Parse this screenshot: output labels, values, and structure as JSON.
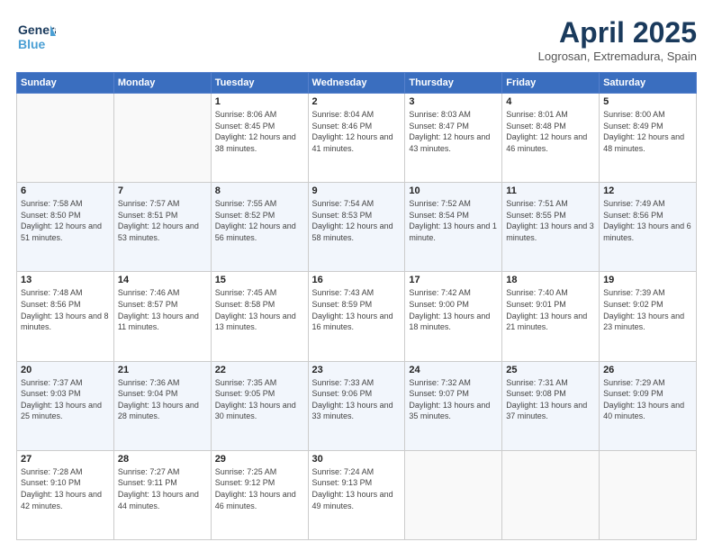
{
  "header": {
    "logo_general": "General",
    "logo_blue": "Blue",
    "month": "April 2025",
    "location": "Logrosan, Extremadura, Spain"
  },
  "days_of_week": [
    "Sunday",
    "Monday",
    "Tuesday",
    "Wednesday",
    "Thursday",
    "Friday",
    "Saturday"
  ],
  "weeks": [
    [
      {
        "day": "",
        "info": ""
      },
      {
        "day": "",
        "info": ""
      },
      {
        "day": "1",
        "info": "Sunrise: 8:06 AM\nSunset: 8:45 PM\nDaylight: 12 hours and 38 minutes."
      },
      {
        "day": "2",
        "info": "Sunrise: 8:04 AM\nSunset: 8:46 PM\nDaylight: 12 hours and 41 minutes."
      },
      {
        "day": "3",
        "info": "Sunrise: 8:03 AM\nSunset: 8:47 PM\nDaylight: 12 hours and 43 minutes."
      },
      {
        "day": "4",
        "info": "Sunrise: 8:01 AM\nSunset: 8:48 PM\nDaylight: 12 hours and 46 minutes."
      },
      {
        "day": "5",
        "info": "Sunrise: 8:00 AM\nSunset: 8:49 PM\nDaylight: 12 hours and 48 minutes."
      }
    ],
    [
      {
        "day": "6",
        "info": "Sunrise: 7:58 AM\nSunset: 8:50 PM\nDaylight: 12 hours and 51 minutes."
      },
      {
        "day": "7",
        "info": "Sunrise: 7:57 AM\nSunset: 8:51 PM\nDaylight: 12 hours and 53 minutes."
      },
      {
        "day": "8",
        "info": "Sunrise: 7:55 AM\nSunset: 8:52 PM\nDaylight: 12 hours and 56 minutes."
      },
      {
        "day": "9",
        "info": "Sunrise: 7:54 AM\nSunset: 8:53 PM\nDaylight: 12 hours and 58 minutes."
      },
      {
        "day": "10",
        "info": "Sunrise: 7:52 AM\nSunset: 8:54 PM\nDaylight: 13 hours and 1 minute."
      },
      {
        "day": "11",
        "info": "Sunrise: 7:51 AM\nSunset: 8:55 PM\nDaylight: 13 hours and 3 minutes."
      },
      {
        "day": "12",
        "info": "Sunrise: 7:49 AM\nSunset: 8:56 PM\nDaylight: 13 hours and 6 minutes."
      }
    ],
    [
      {
        "day": "13",
        "info": "Sunrise: 7:48 AM\nSunset: 8:56 PM\nDaylight: 13 hours and 8 minutes."
      },
      {
        "day": "14",
        "info": "Sunrise: 7:46 AM\nSunset: 8:57 PM\nDaylight: 13 hours and 11 minutes."
      },
      {
        "day": "15",
        "info": "Sunrise: 7:45 AM\nSunset: 8:58 PM\nDaylight: 13 hours and 13 minutes."
      },
      {
        "day": "16",
        "info": "Sunrise: 7:43 AM\nSunset: 8:59 PM\nDaylight: 13 hours and 16 minutes."
      },
      {
        "day": "17",
        "info": "Sunrise: 7:42 AM\nSunset: 9:00 PM\nDaylight: 13 hours and 18 minutes."
      },
      {
        "day": "18",
        "info": "Sunrise: 7:40 AM\nSunset: 9:01 PM\nDaylight: 13 hours and 21 minutes."
      },
      {
        "day": "19",
        "info": "Sunrise: 7:39 AM\nSunset: 9:02 PM\nDaylight: 13 hours and 23 minutes."
      }
    ],
    [
      {
        "day": "20",
        "info": "Sunrise: 7:37 AM\nSunset: 9:03 PM\nDaylight: 13 hours and 25 minutes."
      },
      {
        "day": "21",
        "info": "Sunrise: 7:36 AM\nSunset: 9:04 PM\nDaylight: 13 hours and 28 minutes."
      },
      {
        "day": "22",
        "info": "Sunrise: 7:35 AM\nSunset: 9:05 PM\nDaylight: 13 hours and 30 minutes."
      },
      {
        "day": "23",
        "info": "Sunrise: 7:33 AM\nSunset: 9:06 PM\nDaylight: 13 hours and 33 minutes."
      },
      {
        "day": "24",
        "info": "Sunrise: 7:32 AM\nSunset: 9:07 PM\nDaylight: 13 hours and 35 minutes."
      },
      {
        "day": "25",
        "info": "Sunrise: 7:31 AM\nSunset: 9:08 PM\nDaylight: 13 hours and 37 minutes."
      },
      {
        "day": "26",
        "info": "Sunrise: 7:29 AM\nSunset: 9:09 PM\nDaylight: 13 hours and 40 minutes."
      }
    ],
    [
      {
        "day": "27",
        "info": "Sunrise: 7:28 AM\nSunset: 9:10 PM\nDaylight: 13 hours and 42 minutes."
      },
      {
        "day": "28",
        "info": "Sunrise: 7:27 AM\nSunset: 9:11 PM\nDaylight: 13 hours and 44 minutes."
      },
      {
        "day": "29",
        "info": "Sunrise: 7:25 AM\nSunset: 9:12 PM\nDaylight: 13 hours and 46 minutes."
      },
      {
        "day": "30",
        "info": "Sunrise: 7:24 AM\nSunset: 9:13 PM\nDaylight: 13 hours and 49 minutes."
      },
      {
        "day": "",
        "info": ""
      },
      {
        "day": "",
        "info": ""
      },
      {
        "day": "",
        "info": ""
      }
    ]
  ]
}
